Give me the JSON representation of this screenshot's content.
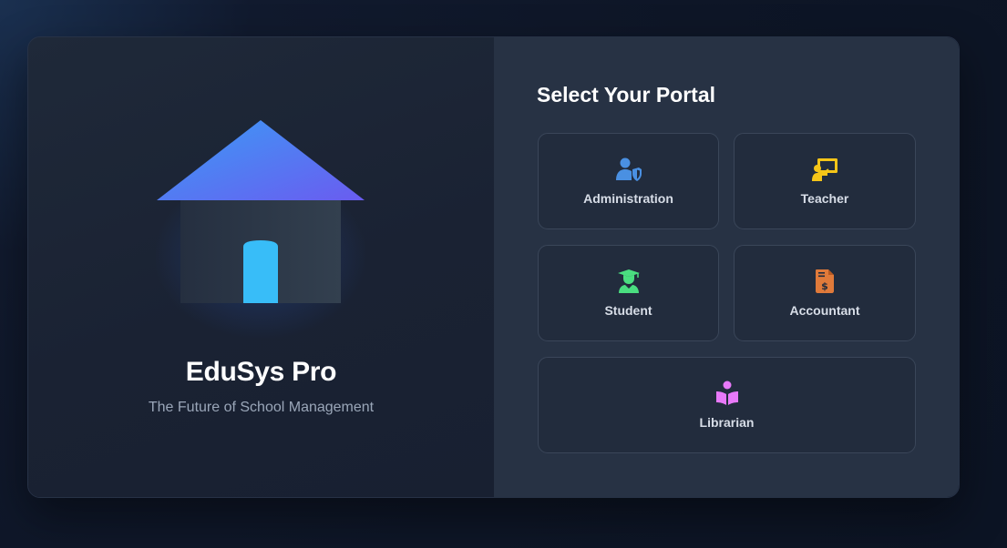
{
  "brand": {
    "name": "EduSys Pro",
    "tagline": "The Future of School Management"
  },
  "portal": {
    "title": "Select Your Portal",
    "options": [
      {
        "label": "Administration",
        "icon": "user-shield-icon",
        "color": "#4a90e2"
      },
      {
        "label": "Teacher",
        "icon": "chalkboard-teacher-icon",
        "color": "#f5c518"
      },
      {
        "label": "Student",
        "icon": "user-graduate-icon",
        "color": "#4ade80"
      },
      {
        "label": "Accountant",
        "icon": "file-invoice-dollar-icon",
        "color": "#e07a3a"
      },
      {
        "label": "Librarian",
        "icon": "book-reader-icon",
        "color": "#e879f9"
      }
    ]
  },
  "colors": {
    "accent_blue": "#38bdf8",
    "roof_gradient_start": "#3b82f6",
    "roof_gradient_end": "#6366f1"
  }
}
